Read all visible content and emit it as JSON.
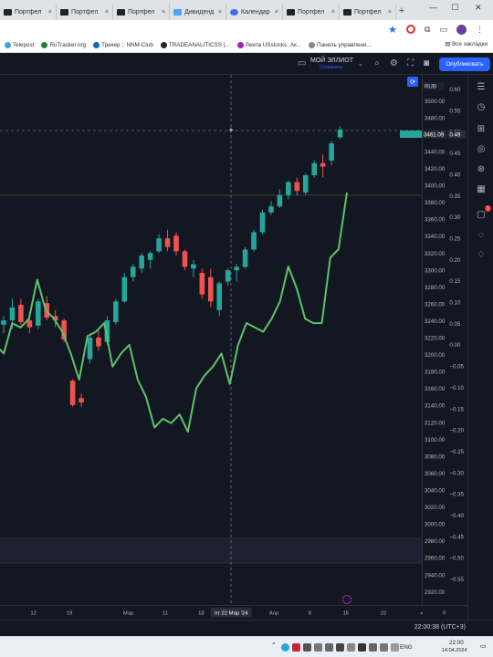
{
  "browser": {
    "tabs": [
      {
        "label": "Портфел",
        "icon": "portfolio-icon"
      },
      {
        "label": "Портфел",
        "icon": "portfolio-icon"
      },
      {
        "label": "Портфел",
        "icon": "portfolio-icon"
      },
      {
        "label": "Дивиденд",
        "icon": "dividend-icon"
      },
      {
        "label": "Календар",
        "icon": "calendar-icon"
      },
      {
        "label": "Портфел",
        "icon": "portfolio-icon"
      },
      {
        "label": "Портфел",
        "icon": "portfolio-icon"
      }
    ],
    "new_tab": "+",
    "bookmarks": [
      "Telepost",
      "RuTracker.org",
      "Трекер :: NNM-Club",
      "TRADEANALITICSS |...",
      "Лента USstocks. Ак...",
      "Панель управлени..."
    ],
    "all_bookmarks": "Все закладки"
  },
  "tv": {
    "layout_name": "МОЙ ЭЛЛИОТ",
    "layout_status": "Сохранено",
    "publish_label": "Опубликовать",
    "currency": "RUB",
    "status_time": "22:00:38 (UTC+3)"
  },
  "chart_data": {
    "type": "candlestick+line",
    "left_axis": {
      "ticks": [
        3500,
        3480,
        3460,
        3440,
        3420,
        3400,
        3380,
        3360,
        3340,
        3320,
        3300,
        3280,
        3260,
        3240,
        3220,
        3200,
        3180,
        3160,
        3140,
        3120,
        3100,
        3080,
        3060,
        3040,
        3020,
        3000,
        2980,
        2960,
        2940,
        2920
      ],
      "labels": [
        "3500.00",
        "3480.00",
        "3460.00",
        "3440.00",
        "3420.00",
        "3400.00",
        "3380.00",
        "3360.00",
        "3340.00",
        "3320.00",
        "3300.00",
        "3280.00",
        "3260.00",
        "3240.00",
        "3220.00",
        "3200.00",
        "3180.00",
        "3160.00",
        "3140.00",
        "3120.00",
        "3100.00",
        "3080.00",
        "3060.00",
        "3040.00",
        "3020.00",
        "3000.00",
        "2980.00",
        "2960.00",
        "2940.00",
        "2920.00"
      ]
    },
    "right_axis": {
      "ticks": [
        0.6,
        0.55,
        0.5,
        0.45,
        0.4,
        0.35,
        0.3,
        0.25,
        0.2,
        0.15,
        0.1,
        0.05,
        0.0,
        -0.05,
        -0.1,
        -0.15,
        -0.2,
        -0.25,
        -0.3,
        -0.35,
        -0.4,
        -0.45,
        -0.5,
        -0.55
      ],
      "labels": [
        "0.60",
        "0.55",
        "0.50",
        "0.45",
        "0.40",
        "0.35",
        "0.30",
        "0.25",
        "0.20",
        "0.15",
        "0.10",
        "0.05",
        "0.00",
        "−0.05",
        "−0.10",
        "−0.15",
        "−0.20",
        "−0.25",
        "−0.30",
        "−0.35",
        "−0.40",
        "−0.45",
        "−0.50",
        "−0.55"
      ]
    },
    "x_labels": [
      "12",
      "19",
      "Мар",
      "11",
      "18",
      "пт 22 Мар '24",
      "Апр",
      "8",
      "15",
      "22"
    ],
    "last_price_label": "3461.09",
    "last_line_label": "0.49",
    "candles": [
      {
        "o": 3235,
        "h": 3245,
        "l": 3225,
        "c": 3240
      },
      {
        "o": 3240,
        "h": 3265,
        "l": 3230,
        "c": 3255
      },
      {
        "o": 3258,
        "h": 3265,
        "l": 3235,
        "c": 3238
      },
      {
        "o": 3240,
        "h": 3250,
        "l": 3225,
        "c": 3232
      },
      {
        "o": 3234,
        "h": 3265,
        "l": 3230,
        "c": 3262
      },
      {
        "o": 3260,
        "h": 3268,
        "l": 3240,
        "c": 3243
      },
      {
        "o": 3245,
        "h": 3252,
        "l": 3232,
        "c": 3240
      },
      {
        "o": 3240,
        "h": 3242,
        "l": 3215,
        "c": 3218
      },
      {
        "o": 3170,
        "h": 3172,
        "l": 3140,
        "c": 3142
      },
      {
        "o": 3150,
        "h": 3155,
        "l": 3140,
        "c": 3145
      },
      {
        "o": 3195,
        "h": 3225,
        "l": 3190,
        "c": 3220
      },
      {
        "o": 3220,
        "h": 3228,
        "l": 3205,
        "c": 3210
      },
      {
        "o": 3215,
        "h": 3245,
        "l": 3212,
        "c": 3240
      },
      {
        "o": 3238,
        "h": 3265,
        "l": 3235,
        "c": 3262
      },
      {
        "o": 3262,
        "h": 3295,
        "l": 3260,
        "c": 3290
      },
      {
        "o": 3290,
        "h": 3305,
        "l": 3285,
        "c": 3302
      },
      {
        "o": 3300,
        "h": 3318,
        "l": 3295,
        "c": 3315
      },
      {
        "o": 3310,
        "h": 3320,
        "l": 3300,
        "c": 3318
      },
      {
        "o": 3320,
        "h": 3340,
        "l": 3318,
        "c": 3335
      },
      {
        "o": 3335,
        "h": 3345,
        "l": 3320,
        "c": 3325
      },
      {
        "o": 3338,
        "h": 3342,
        "l": 3315,
        "c": 3320
      },
      {
        "o": 3320,
        "h": 3322,
        "l": 3298,
        "c": 3302
      },
      {
        "o": 3300,
        "h": 3310,
        "l": 3290,
        "c": 3305
      },
      {
        "o": 3295,
        "h": 3300,
        "l": 3265,
        "c": 3270
      },
      {
        "o": 3290,
        "h": 3300,
        "l": 3255,
        "c": 3262
      },
      {
        "o": 3252,
        "h": 3285,
        "l": 3245,
        "c": 3283
      },
      {
        "o": 3285,
        "h": 3300,
        "l": 3280,
        "c": 3298
      },
      {
        "o": 3298,
        "h": 3305,
        "l": 3285,
        "c": 3302
      },
      {
        "o": 3302,
        "h": 3325,
        "l": 3300,
        "c": 3322
      },
      {
        "o": 3322,
        "h": 3345,
        "l": 3320,
        "c": 3342
      },
      {
        "o": 3342,
        "h": 3368,
        "l": 3340,
        "c": 3365
      },
      {
        "o": 3365,
        "h": 3378,
        "l": 3362,
        "c": 3372
      },
      {
        "o": 3372,
        "h": 3392,
        "l": 3370,
        "c": 3385
      },
      {
        "o": 3385,
        "h": 3402,
        "l": 3380,
        "c": 3400
      },
      {
        "o": 3400,
        "h": 3405,
        "l": 3385,
        "c": 3390
      },
      {
        "o": 3388,
        "h": 3410,
        "l": 3385,
        "c": 3408
      },
      {
        "o": 3408,
        "h": 3425,
        "l": 3405,
        "c": 3422
      },
      {
        "o": 3422,
        "h": 3432,
        "l": 3405,
        "c": 3418
      },
      {
        "o": 3425,
        "h": 3448,
        "l": 3420,
        "c": 3445
      },
      {
        "o": 3452,
        "h": 3465,
        "l": 3450,
        "c": 3461
      }
    ],
    "indicator_line": [
      0.0,
      -0.02,
      0.05,
      0.04,
      0.06,
      0.15,
      0.08,
      0.06,
      0.03,
      -0.02,
      -0.08,
      0.02,
      0.03,
      0.05,
      -0.05,
      -0.02,
      0.0,
      -0.08,
      -0.12,
      -0.19,
      -0.17,
      -0.18,
      -0.16,
      -0.2,
      -0.1,
      -0.07,
      -0.05,
      -0.02,
      -0.09,
      0.0,
      0.05,
      0.04,
      0.03,
      0.06,
      0.1,
      0.18,
      0.13,
      0.06,
      0.05,
      0.05,
      0.2,
      0.22,
      0.35
    ]
  },
  "taskbar": {
    "lang": "ENG",
    "time": "22:00",
    "date": "14.04.2024"
  }
}
